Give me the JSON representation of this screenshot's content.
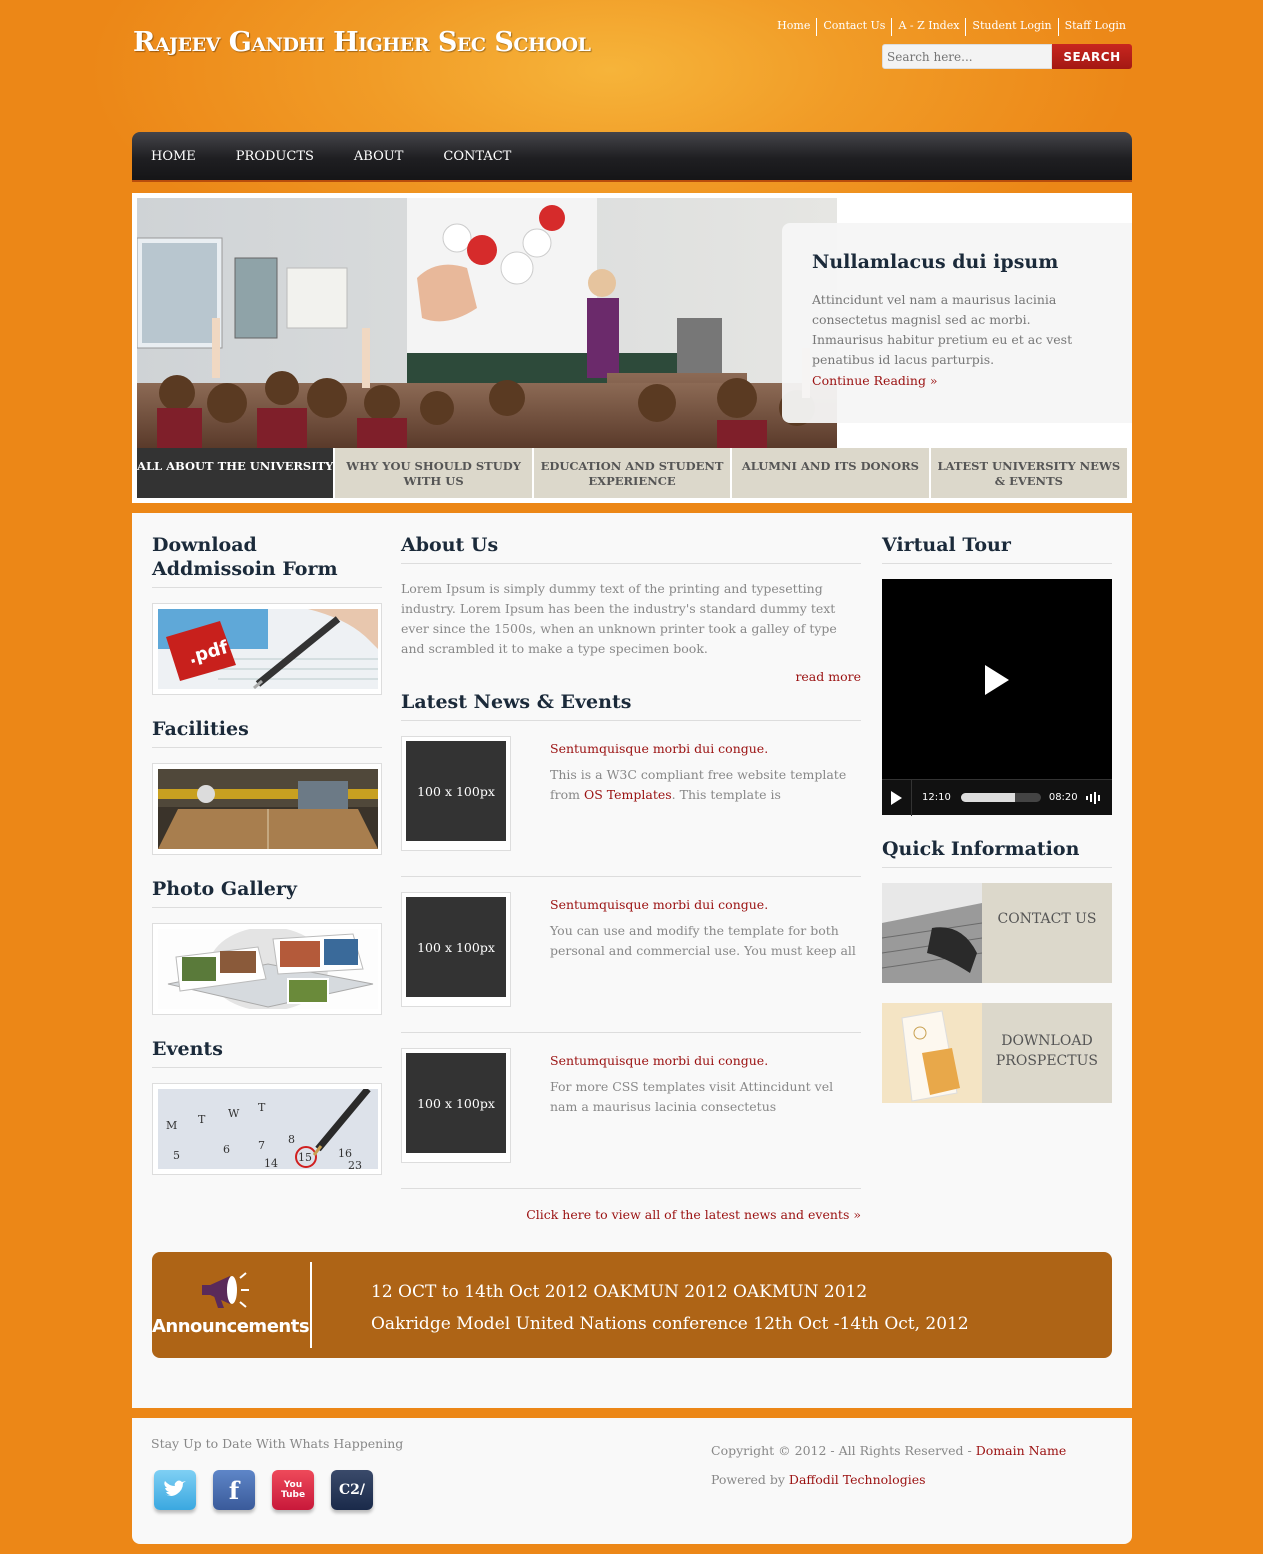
{
  "header": {
    "title": "Rajeev Gandhi Higher Sec School",
    "top_links": [
      "Home",
      "Contact Us",
      "A - Z Index",
      "Student Login",
      "Staff Login"
    ],
    "search": {
      "placeholder": "Search here...",
      "button": "SEARCH"
    }
  },
  "nav": [
    "HOME",
    "PRODUCTS",
    "ABOUT",
    "CONTACT"
  ],
  "slider": {
    "caption_title": "Nullamlacus dui ipsum",
    "caption_text": "Attincidunt vel nam a maurisus lacinia consectetus magnisl sed ac morbi. Inmaurisus habitur pretium eu et ac vest penatibus id lacus parturpis.",
    "caption_link": "Continue Reading »",
    "tabs": [
      "All about the University",
      "Why you should study with us",
      "Education and student experience",
      "Alumni and its donors",
      "Latest University news & events"
    ]
  },
  "left": {
    "download_title": "Download Addmissoin Form",
    "facilities_title": "Facilities",
    "gallery_title": "Photo Gallery",
    "events_title": "Events"
  },
  "about": {
    "title": "About Us",
    "text": "Lorem Ipsum is simply dummy text of the printing and typesetting industry. Lorem Ipsum has been the industry's standard dummy text ever since the 1500s, when an unknown printer took a galley of type and scrambled it to make a type specimen book.",
    "read_more": "read more"
  },
  "news": {
    "title": "Latest News & Events",
    "placeholder": "100 x 100px",
    "items": [
      {
        "title": "Sentumquisque morbi dui congue.",
        "text_a": "This is a W3C compliant free website template from ",
        "link": "OS Templates",
        "text_b": ". This template is"
      },
      {
        "title": "Sentumquisque morbi dui congue.",
        "text_a": "You can use and modify the template for both personal and commercial use. You must keep all",
        "link": "",
        "text_b": ""
      },
      {
        "title": "Sentumquisque morbi dui congue.",
        "text_a": "For more CSS templates visit Attincidunt vel nam a maurisus lacinia consectetus",
        "link": "",
        "text_b": ""
      }
    ],
    "all_link": "Click here to view all of the latest news and events »"
  },
  "right": {
    "tour_title": "Virtual Tour",
    "video_current": "12:10",
    "video_total": "08:20",
    "video_progress": 0.68,
    "quick_title": "Quick Information",
    "contact_label": "CONTACT US",
    "prospectus_label": "DOWNLOAD PROSPECTUS"
  },
  "announcement": {
    "label": "Announcements",
    "line1": "12 OCT to 14th Oct 2012 OAKMUN 2012 OAKMUN 2012",
    "line2": "Oakridge Model United Nations conference 12th Oct -14th Oct, 2012"
  },
  "footer": {
    "stay": "Stay Up to Date With Whats Happening",
    "copyright": "Copyright © 2012 - All Rights Reserved - ",
    "domain": "Domain Name",
    "powered": "Powered by ",
    "company": "Daffodil Technologies",
    "social": [
      "twitter",
      "facebook",
      "youtube",
      "c2"
    ]
  },
  "colors": {
    "orange": "#ec8717",
    "dark": "#1b2a3a",
    "accent": "#9a1010",
    "announce": "#ae6416"
  }
}
